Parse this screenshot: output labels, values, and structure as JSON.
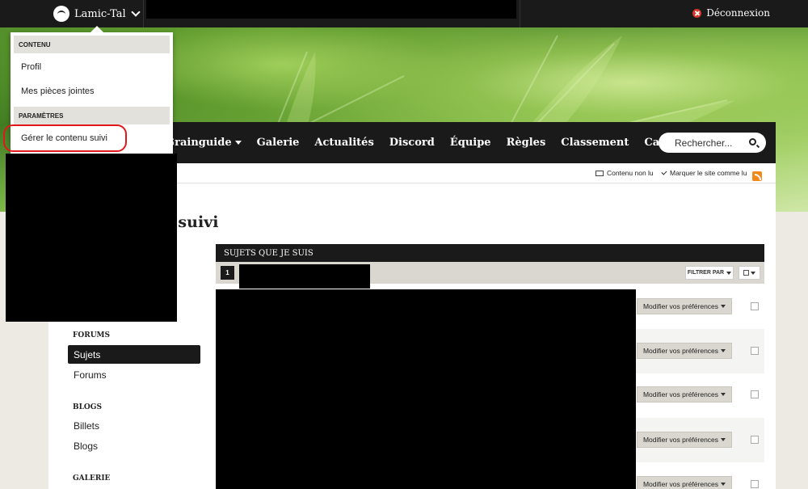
{
  "topbar": {
    "username": "Lamic-Tal",
    "logout_label": "Déconnexion"
  },
  "nav": {
    "items": [
      {
        "label": "Grainguide",
        "has_caret": true
      },
      {
        "label": "Galerie"
      },
      {
        "label": "Actualités"
      },
      {
        "label": "Discord"
      },
      {
        "label": "Équipe"
      },
      {
        "label": "Règles"
      },
      {
        "label": "Classement"
      },
      {
        "label": "CannaWiki"
      }
    ],
    "search_placeholder": "Rechercher..."
  },
  "subbar": {
    "unread_label": "Contenu non lu",
    "mark_read_label": "Marquer le site comme lu"
  },
  "page": {
    "title_partial": "u suivi"
  },
  "sidebar": {
    "sections": [
      {
        "heading": "FORUMS",
        "items": [
          {
            "label": "Sujets",
            "active": true
          },
          {
            "label": "Forums"
          }
        ]
      },
      {
        "heading": "BLOGS",
        "items": [
          {
            "label": "Billets"
          },
          {
            "label": "Blogs"
          }
        ]
      },
      {
        "heading": "GALERIE",
        "items": []
      }
    ]
  },
  "topics": {
    "header": "SUJETS QUE JE SUIS",
    "page_number": "1",
    "filter_label": "FILTRER PAR",
    "row_button_label": "Modifier vos préférences"
  },
  "dropdown": {
    "section1_heading": "CONTENU",
    "profile": "Profil",
    "attachments": "Mes pièces jointes",
    "section2_heading": "PARAMÈTRES",
    "manage_followed": "Gérer le contenu suivi"
  },
  "colors": {
    "dark": "#1a1a1a",
    "highlight": "#e0181b",
    "rss": "#f28a1a",
    "logout_icon": "#d9362b"
  }
}
